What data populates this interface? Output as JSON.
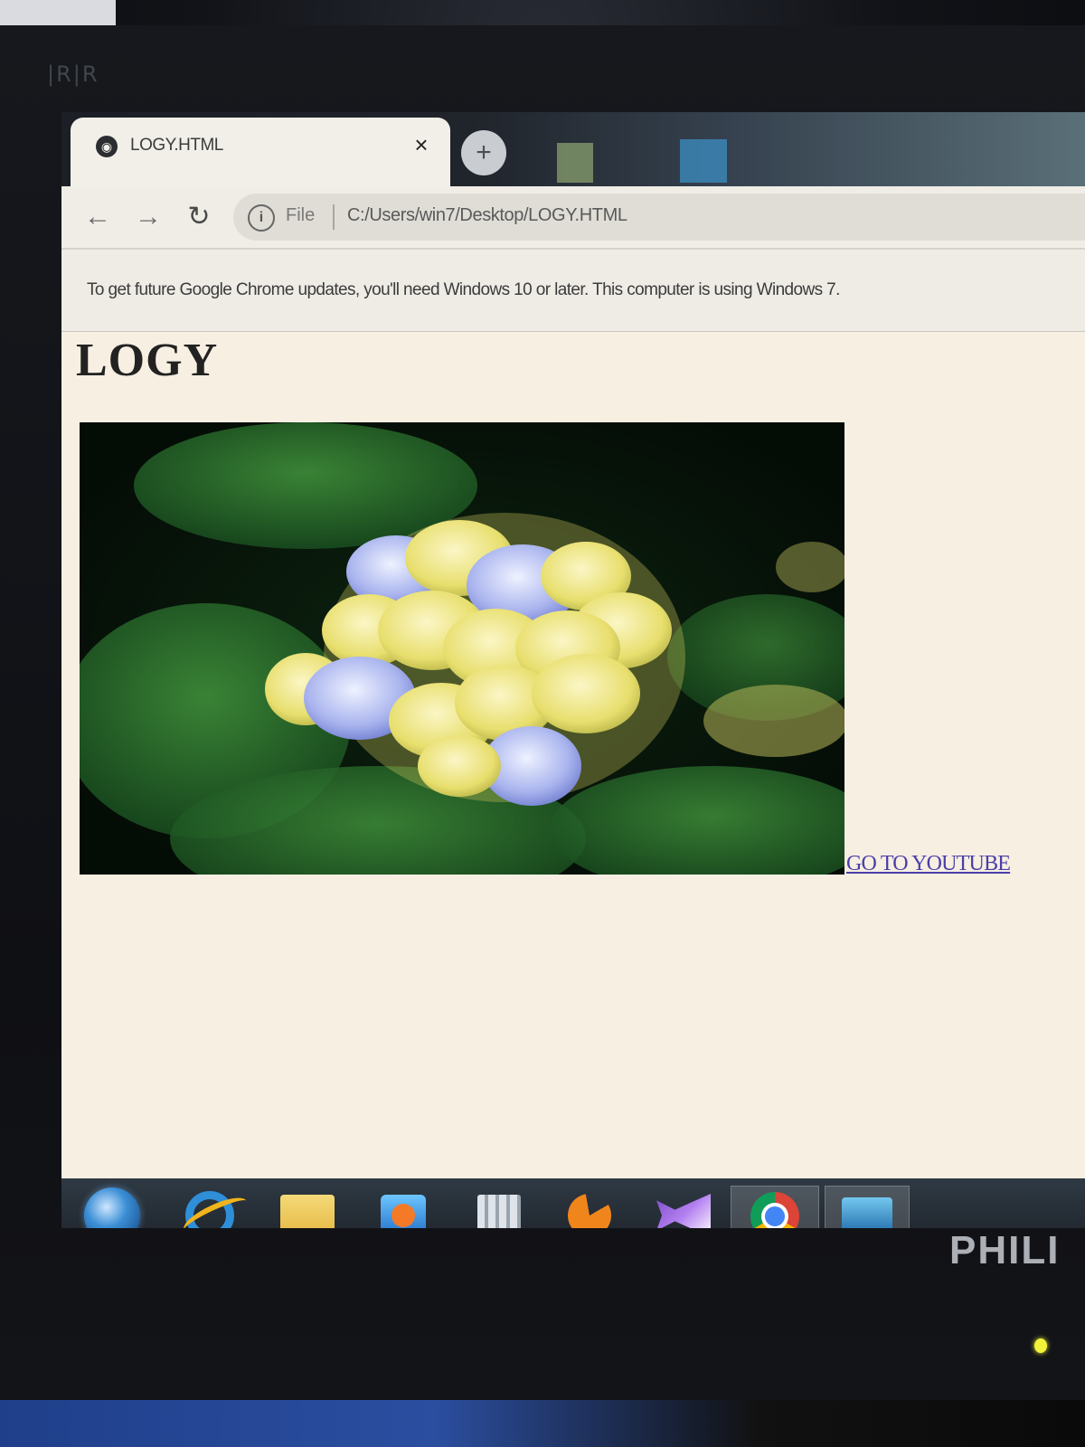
{
  "browser": {
    "tab": {
      "title": "LOGY.HTML",
      "icon": "globe-icon",
      "close_glyph": "×"
    },
    "new_tab_glyph": "+",
    "toolbar": {
      "back_glyph": "←",
      "forward_glyph": "→",
      "reload_glyph": "↻",
      "info_glyph": "i",
      "scheme_label": "File",
      "url": "C:/Users/win7/Desktop/LOGY.HTML"
    },
    "infobar": {
      "message": "To get future Google Chrome updates, you'll need Windows 10 or later. This computer is using Windows 7."
    }
  },
  "page": {
    "heading": "LOGY",
    "image_subject": "hydrangea-flower-image",
    "link_text": "GO TO YOUTUBE"
  },
  "taskbar": {
    "items": [
      {
        "icon": "windows-start-icon"
      },
      {
        "icon": "internet-explorer-icon"
      },
      {
        "icon": "file-explorer-icon"
      },
      {
        "icon": "media-player-icon"
      },
      {
        "icon": "movie-maker-icon"
      },
      {
        "icon": "game-icon"
      },
      {
        "icon": "visual-studio-icon"
      },
      {
        "icon": "chrome-icon",
        "active": true
      },
      {
        "icon": "photo-gallery-icon"
      }
    ]
  },
  "monitor": {
    "brand": "PHILI"
  },
  "colors": {
    "page_background": "#f6efe2",
    "link": "#4b3fa8",
    "browser_chrome": "#efede6"
  }
}
